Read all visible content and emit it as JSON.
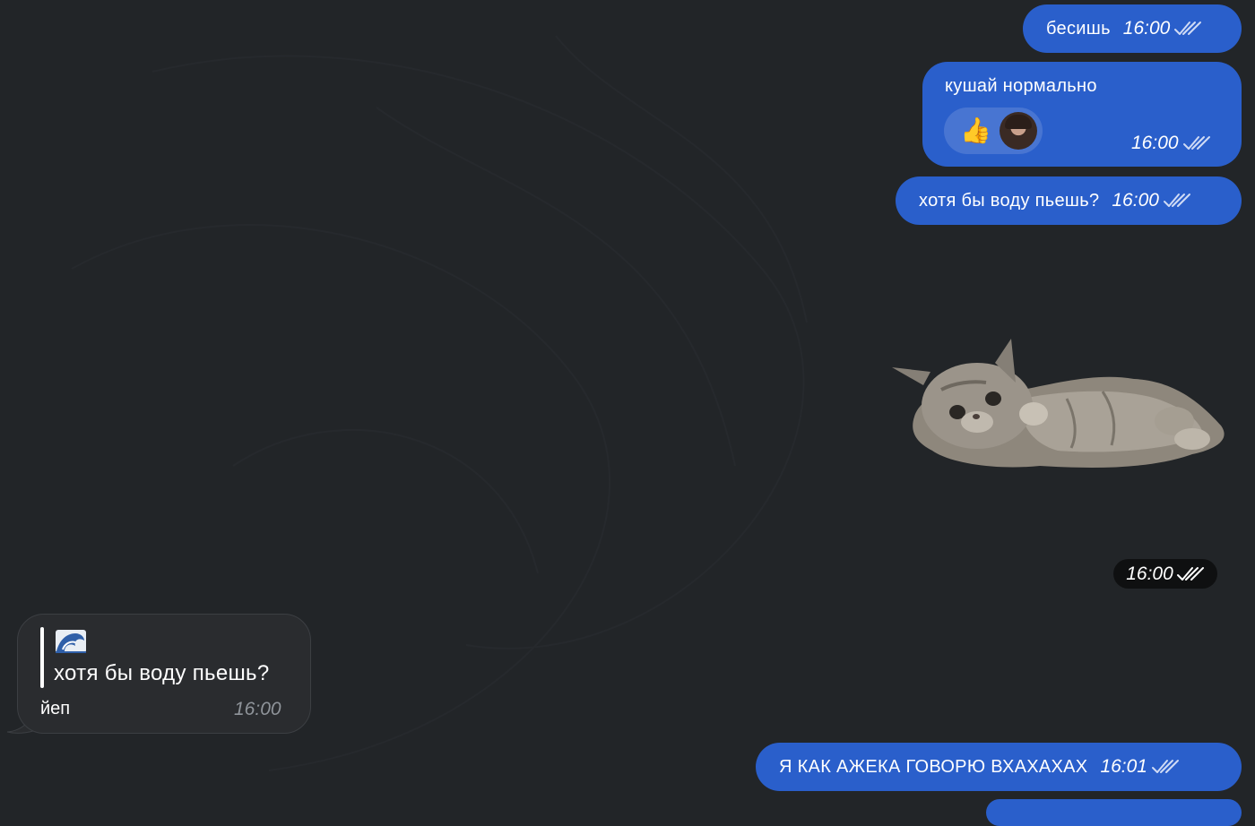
{
  "chat": {
    "background_color": "#222528",
    "outgoing_bubble_color": "#2a5fcb",
    "incoming_bubble_color": "#2a2c2f",
    "messages": [
      {
        "text": "бесишь",
        "time": "16:00",
        "status": "read"
      },
      {
        "text": "кушай нормально",
        "time": "16:00",
        "status": "read",
        "reactions": [
          {
            "emoji": "👍",
            "by": "avatar"
          }
        ]
      },
      {
        "text": "хотя бы воду пьешь?",
        "time": "16:00",
        "status": "read"
      },
      {
        "type": "sticker",
        "sticker": "kitten-lying-on-back",
        "time": "16:00",
        "status": "read"
      },
      {
        "direction": "incoming",
        "reply_emoji": "wave-icon",
        "reply_text": "хотя бы воду пьешь?",
        "text": "йеп",
        "time": "16:00"
      },
      {
        "text": "Я КАК АЖЕКА ГОВОРЮ ВХАХАХАХ",
        "time": "16:01",
        "status": "read"
      }
    ]
  }
}
